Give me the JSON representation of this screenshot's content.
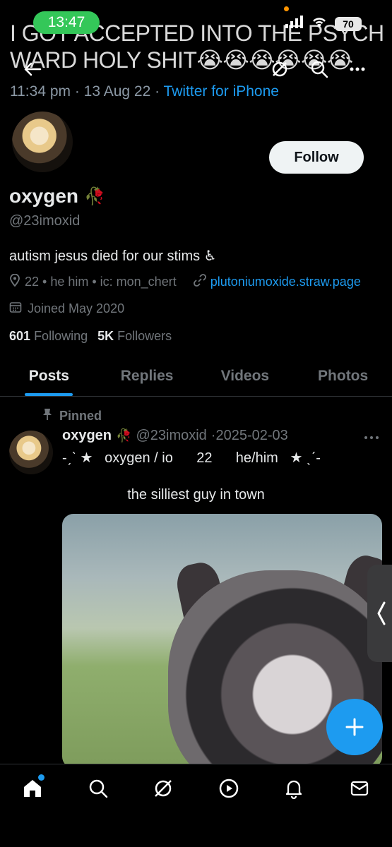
{
  "status_bar": {
    "time": "13:47",
    "battery": "70"
  },
  "banner_tweet": {
    "text": "I GOT ACCEPTED INTO THE PSYCH WARD HOLY SHIT😭😭😭😭😭😭",
    "time": "11:34 pm · 13 Aug 22 · ",
    "source": "Twitter for iPhone"
  },
  "profile": {
    "name": "oxygen",
    "name_emoji": "🥀",
    "handle": "@23imoxid",
    "bio": "autism jesus died for our stims ♿",
    "location": "22 • he him • ic: mon_chert",
    "link": "plutoniumoxide.straw.page",
    "joined": "Joined May 2020",
    "following_count": "601",
    "following_label": "Following",
    "followers_count": "5K",
    "followers_label": "Followers",
    "follow_button": "Follow"
  },
  "tabs": [
    {
      "label": "Posts",
      "active": true
    },
    {
      "label": "Replies"
    },
    {
      "label": "Videos"
    },
    {
      "label": "Photos"
    }
  ],
  "pinned_post": {
    "pinned_label": "Pinned",
    "author_name": "oxygen",
    "author_emoji": "🥀",
    "author_handle": "@23imoxid",
    "date": "·2025-02-03",
    "line2": "-ˏˋ ★   oxygen / io      22      he/him   ★ ˎˊ-",
    "text": "the silliest guy in town"
  },
  "icons": {
    "back": "back-arrow-icon",
    "grok": "grok-icon",
    "search": "search-icon",
    "more": "more-icon"
  },
  "colors": {
    "accent": "#1d9bf0",
    "bg": "#000000",
    "muted": "#71767b"
  }
}
